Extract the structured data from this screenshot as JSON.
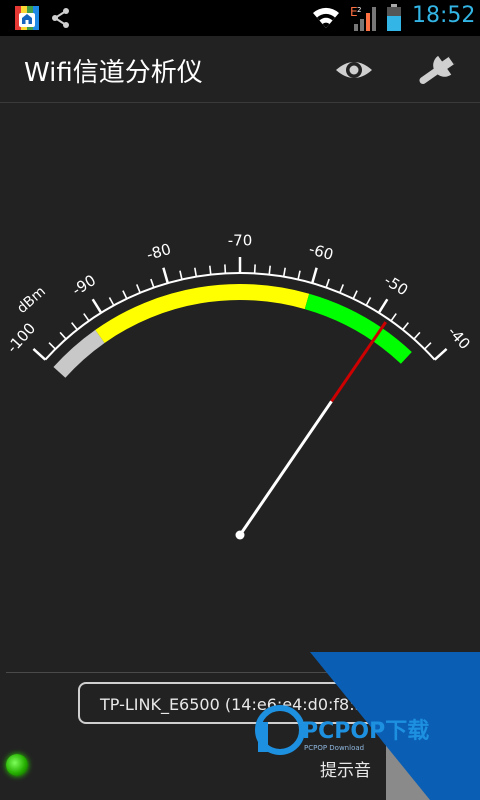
{
  "status_bar": {
    "time": "18:52",
    "network_type": "E",
    "icons": [
      "app-store-icon",
      "share-icon",
      "wifi-icon",
      "signal-icon",
      "battery-icon"
    ]
  },
  "action_bar": {
    "title": "Wifi信道分析仪",
    "icons": [
      "eye-icon",
      "wrench-icon"
    ]
  },
  "gauge": {
    "unit": "dBm",
    "min": -100,
    "max": -40,
    "tick_labels": [
      "-100",
      "-90",
      "-80",
      "-70",
      "-60",
      "-50",
      "-40"
    ],
    "value": -48.5,
    "zones": [
      {
        "from": -100,
        "to": -92,
        "color": "#c8c8c8"
      },
      {
        "from": -92,
        "to": -60,
        "color": "#ffff00"
      },
      {
        "from": -60,
        "to": -43,
        "color": "#00ff00"
      }
    ],
    "needle_color": "#ffffff",
    "needle_tip_color": "#cc0000"
  },
  "footer": {
    "network": "TP-LINK_E6500 (14:e6:e4:d0:f8:30)",
    "sound_label": "提示音"
  },
  "watermark": {
    "brand": "PCPOP下载",
    "sub": "PCPOP Download"
  }
}
